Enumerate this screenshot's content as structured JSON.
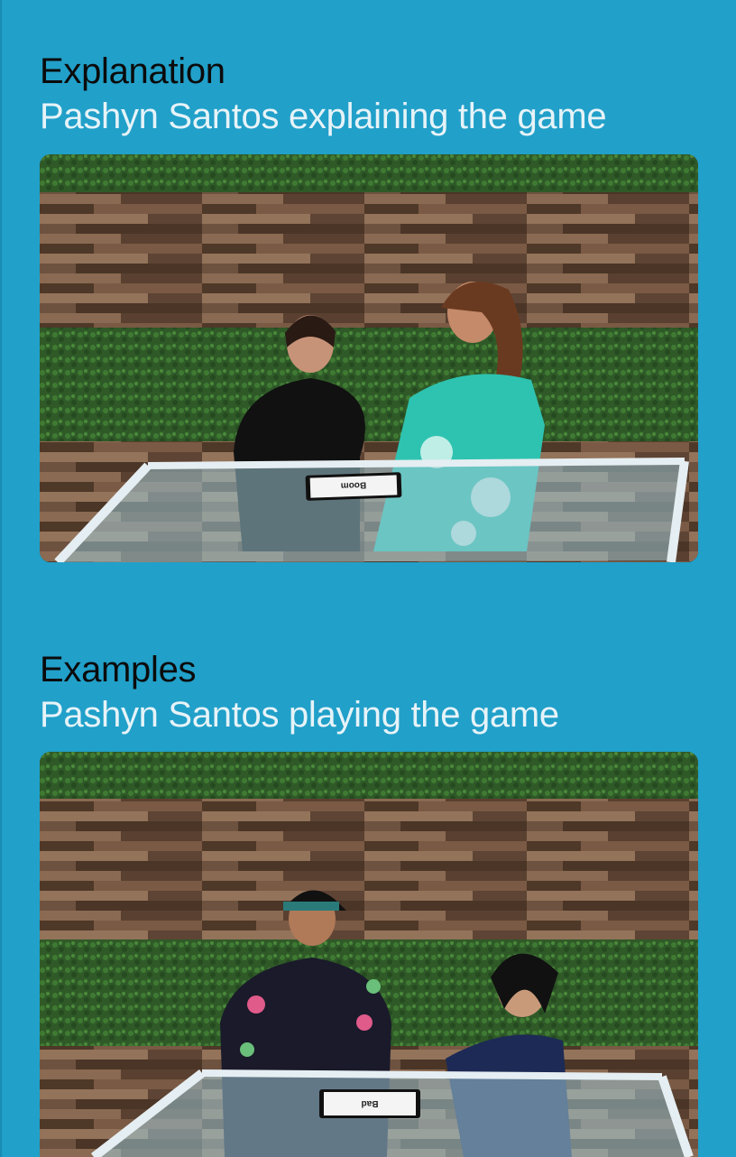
{
  "sections": [
    {
      "title": "Explanation",
      "subtitle": "Pashyn Santos explaining the game",
      "video": {
        "description_icon": "video-thumbnail",
        "card_label": "Boom"
      }
    },
    {
      "title": "Examples",
      "subtitle": "Pashyn Santos playing the game",
      "video": {
        "description_icon": "video-thumbnail",
        "card_label": "Bad"
      }
    }
  ],
  "colors": {
    "background": "#21a0c9",
    "title": "#0b0b0b",
    "subtitle": "#e6f3f8"
  }
}
